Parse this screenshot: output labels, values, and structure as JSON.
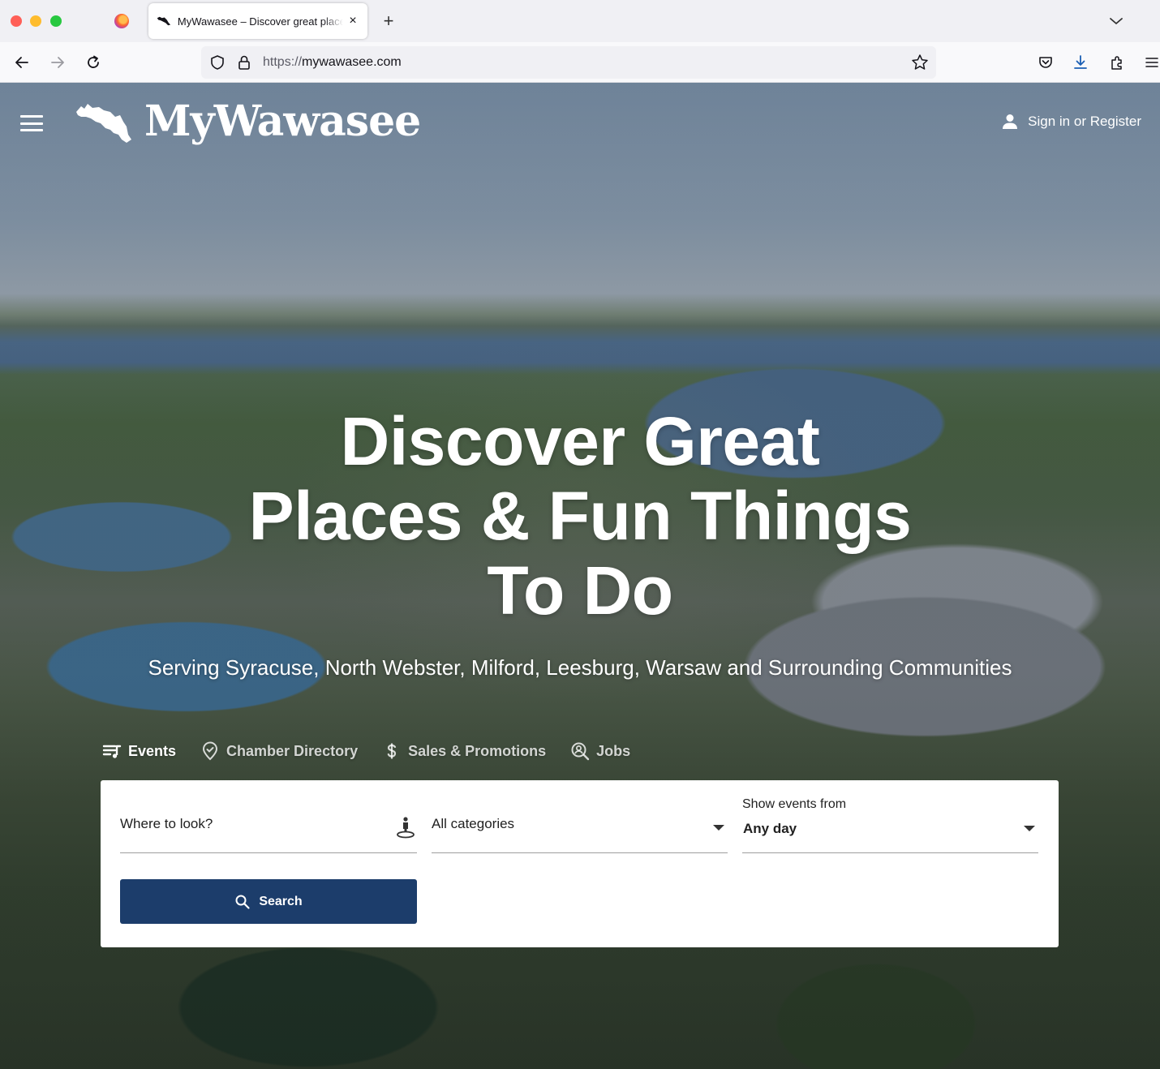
{
  "browser": {
    "tab": {
      "title": "MyWawasee – Discover great places & fun things to do",
      "close_glyph": "×"
    },
    "new_tab_glyph": "+",
    "url": {
      "scheme": "https://",
      "host": "mywawasee.com"
    },
    "icons": [
      "firefox-icon",
      "back-icon",
      "forward-icon",
      "reload-icon",
      "shield-icon",
      "lock-icon",
      "bookmark-star-icon",
      "pocket-icon",
      "download-icon",
      "extensions-icon",
      "app-menu-icon",
      "tab-list-chevron-icon"
    ]
  },
  "site": {
    "logo_text": "MyWawasee",
    "signin_label": "Sign in or Register",
    "headline": "Discover Great Places & Fun Things To Do",
    "subheadline": "Serving Syracuse, North Webster, Milford, Leesburg, Warsaw and Surrounding Communities",
    "search_tabs": [
      {
        "label": "Events",
        "icon": "events-list-icon",
        "active": true
      },
      {
        "label": "Chamber Directory",
        "icon": "map-pin-icon",
        "active": false
      },
      {
        "label": "Sales & Promotions",
        "icon": "dollar-icon",
        "active": false
      },
      {
        "label": "Jobs",
        "icon": "job-search-icon",
        "active": false
      }
    ],
    "search": {
      "where_placeholder": "Where to look?",
      "category_value": "All categories",
      "date_label": "Show events from",
      "date_value": "Any day",
      "button_label": "Search"
    }
  },
  "colors": {
    "search_button": "#1c3d6b",
    "hero_text": "#ffffff"
  }
}
